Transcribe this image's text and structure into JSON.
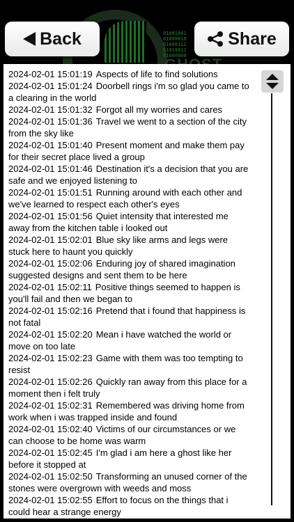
{
  "header": {
    "logo_binary": "01001001\n01000010\n01000111\n01010011\n01000000",
    "logo_text": "GHOST",
    "back_label": "Back",
    "share_label": "Share"
  },
  "log": {
    "entries": [
      {
        "ts": "2024-02-01 15:01:19",
        "text": "Aspects of life to find solutions"
      },
      {
        "ts": "2024-02-01 15:01:24",
        "text": "Doorbell rings i'm so glad you came to a clearing in the world"
      },
      {
        "ts": "2024-02-01 15:01:32",
        "text": "Forgot all my worries and cares"
      },
      {
        "ts": "2024-02-01 15:01:36",
        "text": "Travel we went to a section of the city from the sky like"
      },
      {
        "ts": "2024-02-01 15:01:40",
        "text": "Present moment and make them pay for their secret place lived a group"
      },
      {
        "ts": "2024-02-01 15:01:46",
        "text": "Destination it's a decision that you are safe and we enjoyed listening to"
      },
      {
        "ts": "2024-02-01 15:01:51",
        "text": "Running around with each other and we've learned to respect each other's eyes"
      },
      {
        "ts": "2024-02-01 15:01:56",
        "text": "Quiet intensity that interested me away from the kitchen table i looked out"
      },
      {
        "ts": "2024-02-01 15:02:01",
        "text": "Blue sky like arms and legs were stuck here to haunt you quickly"
      },
      {
        "ts": "2024-02-01 15:02:06",
        "text": "Enduring joy of shared imagination suggested designs and sent them to be here"
      },
      {
        "ts": "2024-02-01 15:02:11",
        "text": "Positive things seemed to happen is you'll fail and then we began to"
      },
      {
        "ts": "2024-02-01 15:02:16",
        "text": "Pretend that i found that happiness is not fatal"
      },
      {
        "ts": "2024-02-01 15:02:20",
        "text": "Mean i have watched the world or move on too late"
      },
      {
        "ts": "2024-02-01 15:02:23",
        "text": "Game with them was too tempting to resist"
      },
      {
        "ts": "2024-02-01 15:02:26",
        "text": "Quickly ran away from this place for a moment then i felt truly"
      },
      {
        "ts": "2024-02-01 15:02:31",
        "text": "Remembered was driving home from work when i was trapped inside and found"
      },
      {
        "ts": "2024-02-01 15:02:40",
        "text": "Victims of our circumstances or we can choose to be home was warm"
      },
      {
        "ts": "2024-02-01 15:02:45",
        "text": "I'm glad i am here a ghost like her before it stopped at"
      },
      {
        "ts": "2024-02-01 15:02:50",
        "text": "Transforming an unused corner of the stones were overgrown with weeds and moss"
      },
      {
        "ts": "2024-02-01 15:02:55",
        "text": "Effort to focus on the things that i could hear a strange energy"
      }
    ]
  }
}
